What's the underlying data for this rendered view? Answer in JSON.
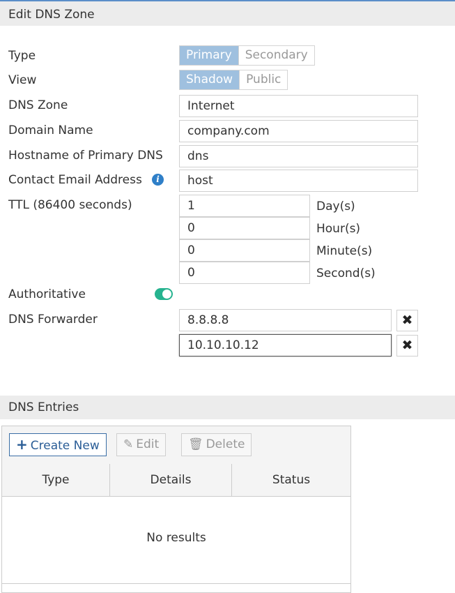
{
  "header": {
    "title": "Edit DNS Zone"
  },
  "form": {
    "type": {
      "label": "Type",
      "options": [
        "Primary",
        "Secondary"
      ],
      "selected": "Primary"
    },
    "view": {
      "label": "View",
      "options": [
        "Shadow",
        "Public"
      ],
      "selected": "Shadow"
    },
    "dns_zone": {
      "label": "DNS Zone",
      "value": "Internet"
    },
    "domain_name": {
      "label": "Domain Name",
      "value": "company.com"
    },
    "primary_dns": {
      "label": "Hostname of Primary DNS",
      "value": "dns"
    },
    "contact_email": {
      "label": "Contact Email Address",
      "value": "host",
      "info_icon": "info-icon"
    },
    "ttl": {
      "label": "TTL (86400 seconds)",
      "days": {
        "value": "1",
        "unit": "Day(s)"
      },
      "hours": {
        "value": "0",
        "unit": "Hour(s)"
      },
      "minutes": {
        "value": "0",
        "unit": "Minute(s)"
      },
      "seconds": {
        "value": "0",
        "unit": "Second(s)"
      }
    },
    "authoritative": {
      "label": "Authoritative",
      "enabled": true,
      "color": "#26b38f"
    },
    "dns_forwarder": {
      "label": "DNS Forwarder",
      "entries": [
        "8.8.8.8",
        "10.10.10.12"
      ],
      "remove_icon": "close-icon"
    }
  },
  "entries": {
    "section_title": "DNS Entries",
    "toolbar": {
      "create_new": "Create New",
      "edit": "Edit",
      "delete": "Delete"
    },
    "columns": [
      "Type",
      "Details",
      "Status"
    ],
    "empty_text": "No results"
  },
  "colors": {
    "accent": "#9fc0df",
    "primary_button": "#2a5d96",
    "info": "#2f7fc8"
  }
}
